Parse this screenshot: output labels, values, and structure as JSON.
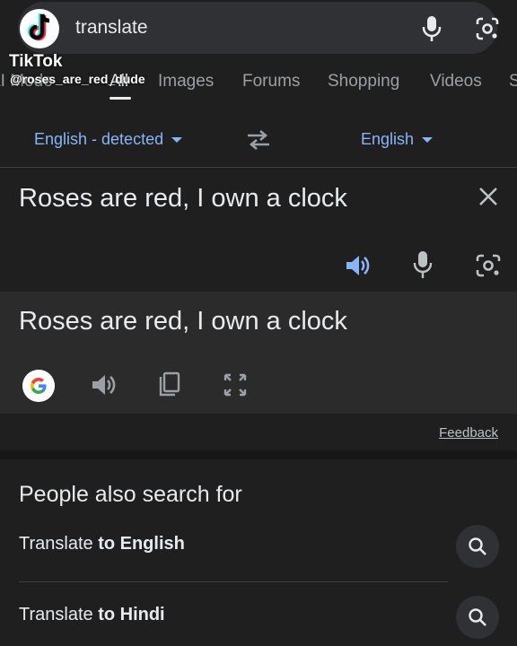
{
  "search": {
    "query": "translate"
  },
  "watermark": {
    "brand": "TikTok",
    "handle": "@roses_are_red_dude"
  },
  "tabs": [
    {
      "label": "AI Mode"
    },
    {
      "label": "All"
    },
    {
      "label": "Images"
    },
    {
      "label": "Forums"
    },
    {
      "label": "Shopping"
    },
    {
      "label": "Videos"
    },
    {
      "label": "S"
    }
  ],
  "translator": {
    "source_lang": "English - detected",
    "target_lang": "English",
    "source_text": "Roses are red, I own a clock",
    "translated_text": "Roses are red, I own a clock",
    "feedback": "Feedback"
  },
  "people_also_search": {
    "title": "People also search for",
    "items": [
      {
        "prefix": "Translate ",
        "bold": "to English"
      },
      {
        "prefix": "Translate ",
        "bold": "to Hindi"
      }
    ]
  },
  "colors": {
    "accent": "#8ab4f8",
    "background": "#1f1f1f",
    "panel": "#2b2b2b"
  }
}
